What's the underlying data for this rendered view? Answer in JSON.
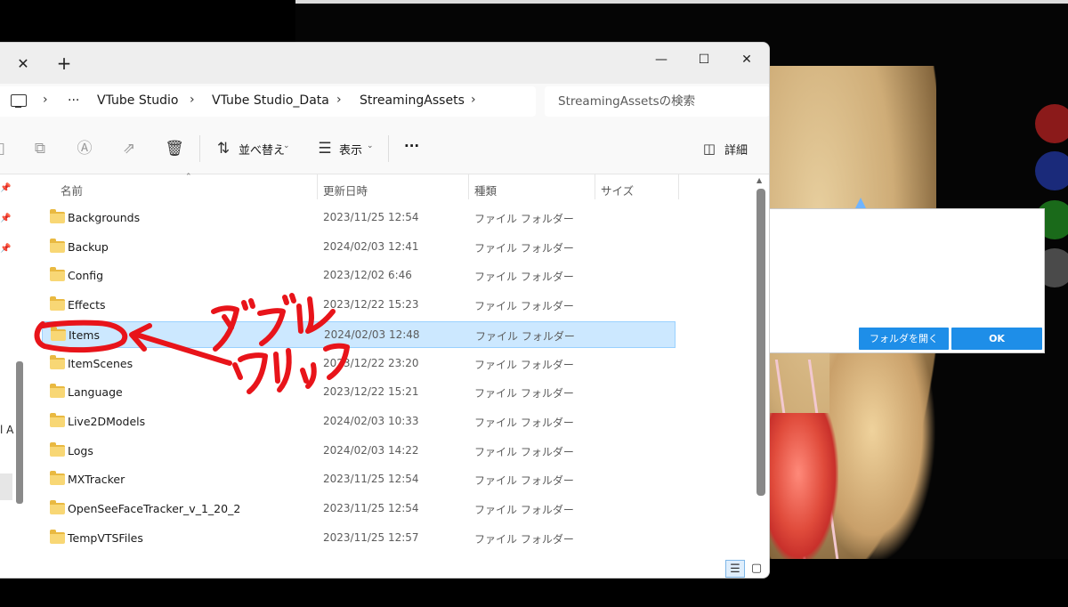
{
  "explorer": {
    "tab_close": "✕",
    "tab_new": "+",
    "window": {
      "minimize": "—",
      "maximize": "☐",
      "close": "✕"
    },
    "breadcrumb": {
      "more": "···",
      "separator": "›",
      "items": [
        "VTube Studio",
        "VTube Studio_Data",
        "StreamingAssets"
      ]
    },
    "search": {
      "placeholder": "StreamingAssetsの検索"
    },
    "toolbar": {
      "sort_label": "並べ替え",
      "view_label": "表示",
      "more_label": "···",
      "details_label": "詳細"
    },
    "columns": {
      "name": "名前",
      "modified": "更新日時",
      "type": "種類",
      "size": "サイズ"
    },
    "nav_partial_text": "l A",
    "files": [
      {
        "name": "Backgrounds",
        "modified": "2023/11/25 12:54",
        "type": "ファイル フォルダー"
      },
      {
        "name": "Backup",
        "modified": "2024/02/03 12:41",
        "type": "ファイル フォルダー"
      },
      {
        "name": "Config",
        "modified": "2023/12/02 6:46",
        "type": "ファイル フォルダー"
      },
      {
        "name": "Effects",
        "modified": "2023/12/22 15:23",
        "type": "ファイル フォルダー"
      },
      {
        "name": "Items",
        "modified": "2024/02/03 12:48",
        "type": "ファイル フォルダー",
        "selected": true
      },
      {
        "name": "ItemScenes",
        "modified": "2023/12/22 23:20",
        "type": "ファイル フォルダー"
      },
      {
        "name": "Language",
        "modified": "2023/12/22 15:21",
        "type": "ファイル フォルダー"
      },
      {
        "name": "Live2DModels",
        "modified": "2024/02/03 10:33",
        "type": "ファイル フォルダー"
      },
      {
        "name": "Logs",
        "modified": "2024/02/03 14:22",
        "type": "ファイル フォルダー"
      },
      {
        "name": "MXTracker",
        "modified": "2023/11/25 12:54",
        "type": "ファイル フォルダー"
      },
      {
        "name": "OpenSeeFaceTracker_v_1_20_2",
        "modified": "2023/11/25 12:54",
        "type": "ファイル フォルダー"
      },
      {
        "name": "TempVTSFiles",
        "modified": "2023/11/25 12:57",
        "type": "ファイル フォルダー"
      }
    ]
  },
  "vts_dialog": {
    "open_folder_label": "フォルダを開く",
    "ok_label": "OK"
  },
  "vts_side_buttons": [
    "#8b1a1a",
    "#1a2a7a",
    "#1a6a1a",
    "#4a4a4a"
  ],
  "annotation": {
    "line1": "ダブル",
    "line2": "クリック",
    "color": "#e8141a"
  },
  "colors": {
    "selection": "#cce8ff",
    "accent_button": "#1e8ee8"
  }
}
